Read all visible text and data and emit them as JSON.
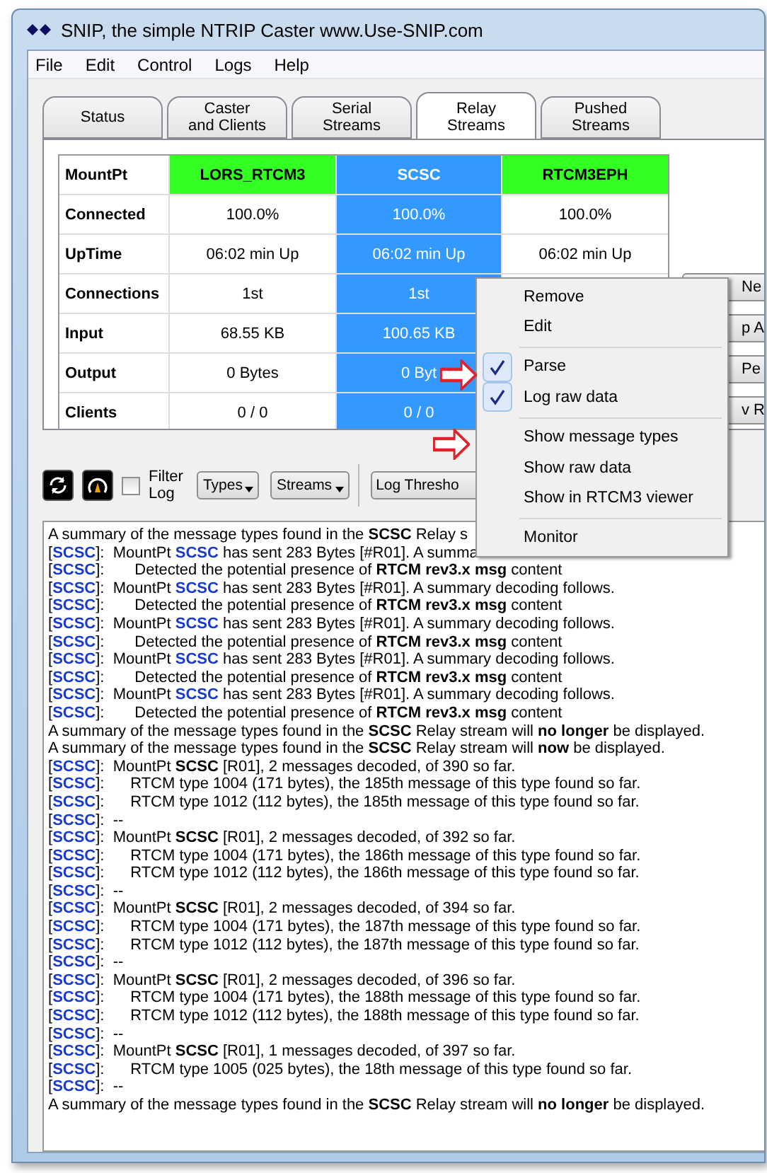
{
  "window": {
    "title": "SNIP, the simple NTRIP Caster  www.Use-SNIP.com"
  },
  "menu_bar": [
    "File",
    "Edit",
    "Control",
    "Logs",
    "Help"
  ],
  "tabs": [
    {
      "label": "Status",
      "selected": false
    },
    {
      "label": "Caster\nand Clients",
      "selected": false
    },
    {
      "label": "Serial\nStreams",
      "selected": false
    },
    {
      "label": "Relay\nStreams",
      "selected": true
    },
    {
      "label": "Pushed\nStreams",
      "selected": false
    }
  ],
  "stream_table": {
    "row_labels": [
      "MountPt",
      "Connected",
      "UpTime",
      "Connections",
      "Input",
      "Output",
      "Clients"
    ],
    "columns": [
      {
        "name": "LORS_RTCM3",
        "color": "#33ff22",
        "selected": false,
        "cells": [
          "100.0%",
          "06:02 min Up",
          "1st",
          "68.55 KB",
          "0 Bytes",
          "0 / 0"
        ]
      },
      {
        "name": "SCSC",
        "color": "#3399ff",
        "selected": true,
        "cells": [
          "100.0%",
          "06:02 min Up",
          "1st",
          "100.65 KB",
          "0 Byt",
          "0 / 0"
        ]
      },
      {
        "name": "RTCM3EPH",
        "color": "#33ff22",
        "selected": false,
        "cells": [
          "100.0%",
          "06:02 min Up"
        ]
      }
    ]
  },
  "side_buttons": [
    "Ne",
    "p A",
    "Pe",
    "v R"
  ],
  "toolbar": {
    "filter_log": {
      "label": "Filter\nLog",
      "checked": false
    },
    "buttons": [
      "Types",
      "Streams"
    ],
    "threshold_button": "Log Thresho"
  },
  "context_menu": [
    {
      "kind": "item",
      "label": "Remove",
      "checked": false
    },
    {
      "kind": "item",
      "label": "Edit",
      "checked": false
    },
    {
      "kind": "separator"
    },
    {
      "kind": "item",
      "label": "Parse",
      "checked": true
    },
    {
      "kind": "item",
      "label": "Log raw data",
      "checked": true
    },
    {
      "kind": "separator"
    },
    {
      "kind": "item",
      "label": "Show message types",
      "checked": false
    },
    {
      "kind": "item",
      "label": "Show raw data",
      "checked": false
    },
    {
      "kind": "item",
      "label": "Show in RTCM3 viewer",
      "checked": false
    },
    {
      "kind": "separator"
    },
    {
      "kind": "item",
      "label": "Monitor",
      "checked": false
    }
  ],
  "log": [
    [
      {
        "kind": "text",
        "text": "A summary of the message types found in the **SCSC** Relay s"
      }
    ],
    [
      {
        "kind": "text",
        "text": "["
      },
      {
        "kind": "source",
        "text": "SCSC"
      },
      {
        "kind": "text",
        "text": "]:  MountPt "
      },
      {
        "kind": "source",
        "text": "SCSC"
      },
      {
        "kind": "text",
        "text": " has sent 283 Bytes [#R01]. A summa"
      }
    ],
    [
      {
        "kind": "text",
        "text": "["
      },
      {
        "kind": "source",
        "text": "SCSC"
      },
      {
        "kind": "text",
        "text": "]:       Detected the potential presence of **RTCM rev3.x msg** content"
      }
    ],
    [
      {
        "kind": "text",
        "text": "["
      },
      {
        "kind": "source",
        "text": "SCSC"
      },
      {
        "kind": "text",
        "text": "]:  MountPt "
      },
      {
        "kind": "source",
        "text": "SCSC"
      },
      {
        "kind": "text",
        "text": " has sent 283 Bytes [#R01]. A summary decoding follows."
      }
    ],
    [
      {
        "kind": "text",
        "text": "["
      },
      {
        "kind": "source",
        "text": "SCSC"
      },
      {
        "kind": "text",
        "text": "]:       Detected the potential presence of **RTCM rev3.x msg** content"
      }
    ],
    [
      {
        "kind": "text",
        "text": "["
      },
      {
        "kind": "source",
        "text": "SCSC"
      },
      {
        "kind": "text",
        "text": "]:  MountPt "
      },
      {
        "kind": "source",
        "text": "SCSC"
      },
      {
        "kind": "text",
        "text": " has sent 283 Bytes [#R01]. A summary decoding follows."
      }
    ],
    [
      {
        "kind": "text",
        "text": "["
      },
      {
        "kind": "source",
        "text": "SCSC"
      },
      {
        "kind": "text",
        "text": "]:       Detected the potential presence of **RTCM rev3.x msg** content"
      }
    ],
    [
      {
        "kind": "text",
        "text": "["
      },
      {
        "kind": "source",
        "text": "SCSC"
      },
      {
        "kind": "text",
        "text": "]:  MountPt "
      },
      {
        "kind": "source",
        "text": "SCSC"
      },
      {
        "kind": "text",
        "text": " has sent 283 Bytes [#R01]. A summary decoding follows."
      }
    ],
    [
      {
        "kind": "text",
        "text": "["
      },
      {
        "kind": "source",
        "text": "SCSC"
      },
      {
        "kind": "text",
        "text": "]:       Detected the potential presence of **RTCM rev3.x msg** content"
      }
    ],
    [
      {
        "kind": "text",
        "text": "["
      },
      {
        "kind": "source",
        "text": "SCSC"
      },
      {
        "kind": "text",
        "text": "]:  MountPt "
      },
      {
        "kind": "source",
        "text": "SCSC"
      },
      {
        "kind": "text",
        "text": " has sent 283 Bytes [#R01]. A summary decoding follows."
      }
    ],
    [
      {
        "kind": "text",
        "text": "["
      },
      {
        "kind": "source",
        "text": "SCSC"
      },
      {
        "kind": "text",
        "text": "]:       Detected the potential presence of **RTCM rev3.x msg** content"
      }
    ],
    [
      {
        "kind": "text",
        "text": "A summary of the message types found in the **SCSC** Relay stream will **no longer** be displayed."
      }
    ],
    [
      {
        "kind": "text",
        "text": "A summary of the message types found in the **SCSC** Relay stream will **now** be displayed."
      }
    ],
    [
      {
        "kind": "text",
        "text": "["
      },
      {
        "kind": "source",
        "text": "SCSC"
      },
      {
        "kind": "text",
        "text": "]:  MountPt **SCSC** [R01], 2 messages decoded, of 390 so far."
      }
    ],
    [
      {
        "kind": "text",
        "text": "["
      },
      {
        "kind": "source",
        "text": "SCSC"
      },
      {
        "kind": "text",
        "text": "]:      RTCM type 1004 (171 bytes), the 185th message of this type found so far."
      }
    ],
    [
      {
        "kind": "text",
        "text": "["
      },
      {
        "kind": "source",
        "text": "SCSC"
      },
      {
        "kind": "text",
        "text": "]:      RTCM type 1012 (112 bytes), the 185th message of this type found so far."
      }
    ],
    [
      {
        "kind": "text",
        "text": "["
      },
      {
        "kind": "source",
        "text": "SCSC"
      },
      {
        "kind": "text",
        "text": "]:  --"
      }
    ],
    [
      {
        "kind": "text",
        "text": "["
      },
      {
        "kind": "source",
        "text": "SCSC"
      },
      {
        "kind": "text",
        "text": "]:  MountPt **SCSC** [R01], 2 messages decoded, of 392 so far."
      }
    ],
    [
      {
        "kind": "text",
        "text": "["
      },
      {
        "kind": "source",
        "text": "SCSC"
      },
      {
        "kind": "text",
        "text": "]:      RTCM type 1004 (171 bytes), the 186th message of this type found so far."
      }
    ],
    [
      {
        "kind": "text",
        "text": "["
      },
      {
        "kind": "source",
        "text": "SCSC"
      },
      {
        "kind": "text",
        "text": "]:      RTCM type 1012 (112 bytes), the 186th message of this type found so far."
      }
    ],
    [
      {
        "kind": "text",
        "text": "["
      },
      {
        "kind": "source",
        "text": "SCSC"
      },
      {
        "kind": "text",
        "text": "]:  --"
      }
    ],
    [
      {
        "kind": "text",
        "text": "["
      },
      {
        "kind": "source",
        "text": "SCSC"
      },
      {
        "kind": "text",
        "text": "]:  MountPt **SCSC** [R01], 2 messages decoded, of 394 so far."
      }
    ],
    [
      {
        "kind": "text",
        "text": "["
      },
      {
        "kind": "source",
        "text": "SCSC"
      },
      {
        "kind": "text",
        "text": "]:      RTCM type 1004 (171 bytes), the 187th message of this type found so far."
      }
    ],
    [
      {
        "kind": "text",
        "text": "["
      },
      {
        "kind": "source",
        "text": "SCSC"
      },
      {
        "kind": "text",
        "text": "]:      RTCM type 1012 (112 bytes), the 187th message of this type found so far."
      }
    ],
    [
      {
        "kind": "text",
        "text": "["
      },
      {
        "kind": "source",
        "text": "SCSC"
      },
      {
        "kind": "text",
        "text": "]:  --"
      }
    ],
    [
      {
        "kind": "text",
        "text": "["
      },
      {
        "kind": "source",
        "text": "SCSC"
      },
      {
        "kind": "text",
        "text": "]:  MountPt **SCSC** [R01], 2 messages decoded, of 396 so far."
      }
    ],
    [
      {
        "kind": "text",
        "text": "["
      },
      {
        "kind": "source",
        "text": "SCSC"
      },
      {
        "kind": "text",
        "text": "]:      RTCM type 1004 (171 bytes), the 188th message of this type found so far."
      }
    ],
    [
      {
        "kind": "text",
        "text": "["
      },
      {
        "kind": "source",
        "text": "SCSC"
      },
      {
        "kind": "text",
        "text": "]:      RTCM type 1012 (112 bytes), the 188th message of this type found so far."
      }
    ],
    [
      {
        "kind": "text",
        "text": "["
      },
      {
        "kind": "source",
        "text": "SCSC"
      },
      {
        "kind": "text",
        "text": "]:  --"
      }
    ],
    [
      {
        "kind": "text",
        "text": "["
      },
      {
        "kind": "source",
        "text": "SCSC"
      },
      {
        "kind": "text",
        "text": "]:  MountPt **SCSC** [R01], 1 messages decoded, of 397 so far."
      }
    ],
    [
      {
        "kind": "text",
        "text": "["
      },
      {
        "kind": "source",
        "text": "SCSC"
      },
      {
        "kind": "text",
        "text": "]:      RTCM type 1005 (025 bytes), the 18th message of this type found so far."
      }
    ],
    [
      {
        "kind": "text",
        "text": "["
      },
      {
        "kind": "source",
        "text": "SCSC"
      },
      {
        "kind": "text",
        "text": "]:  --"
      }
    ],
    [
      {
        "kind": "text",
        "text": "A summary of the message types found in the **SCSC** Relay stream will **no longer** be displayed."
      }
    ]
  ]
}
